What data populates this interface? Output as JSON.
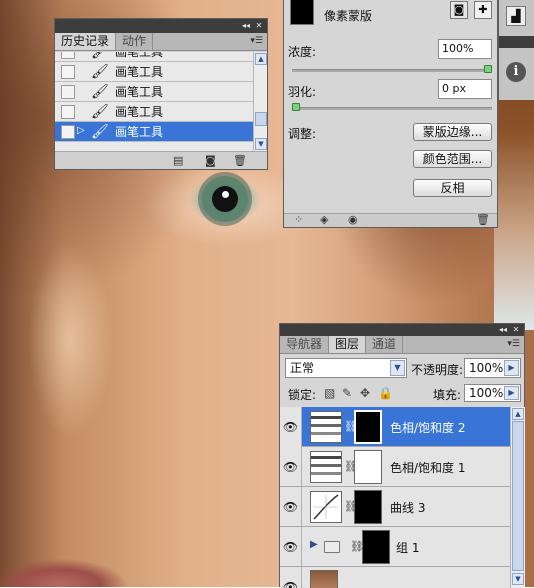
{
  "history_panel": {
    "tabs": [
      {
        "label": "历史记录",
        "active": true
      },
      {
        "label": "动作",
        "active": false
      }
    ],
    "items": [
      {
        "label": "画笔工具",
        "selected": false
      },
      {
        "label": "画笔工具",
        "selected": false
      },
      {
        "label": "画笔工具",
        "selected": false
      },
      {
        "label": "画笔工具",
        "selected": false
      },
      {
        "label": "画笔工具",
        "selected": true
      }
    ],
    "footer_icons": [
      "new-document-from-state-icon",
      "snapshot-camera-icon",
      "trash-icon"
    ]
  },
  "masks_panel": {
    "title": "像素蒙版",
    "density_label": "浓度:",
    "density_value": "100%",
    "feather_label": "羽化:",
    "feather_value": "0 px",
    "adjust_label": "调整:",
    "buttons": {
      "mask_edge": "蒙版边缘...",
      "color_range": "颜色范围...",
      "invert": "反相"
    },
    "density_fraction": 1.0,
    "feather_fraction": 0.0
  },
  "side_strip": {
    "icons": [
      "histogram-icon",
      "info-icon"
    ],
    "info_glyph": "i"
  },
  "layers_panel": {
    "tabs": [
      {
        "label": "导航器",
        "active": false
      },
      {
        "label": "图层",
        "active": true
      },
      {
        "label": "通道",
        "active": false
      }
    ],
    "blend_mode": "正常",
    "opacity_label": "不透明度:",
    "opacity_value": "100%",
    "lock_label": "锁定:",
    "fill_label": "填充:",
    "fill_value": "100%",
    "layers": [
      {
        "name": "色相/饱和度 2",
        "type": "hue-saturation",
        "selected": true
      },
      {
        "name": "色相/饱和度 1",
        "type": "hue-saturation",
        "selected": false
      },
      {
        "name": "曲线 3",
        "type": "curves",
        "selected": false
      },
      {
        "name": "组 1",
        "type": "group",
        "selected": false
      },
      {
        "name": "",
        "type": "image",
        "selected": false
      }
    ]
  },
  "colors": {
    "selection": "#3875d7",
    "panel_bg": "#d6d6d6",
    "titlebar": "#3d3d3d"
  }
}
